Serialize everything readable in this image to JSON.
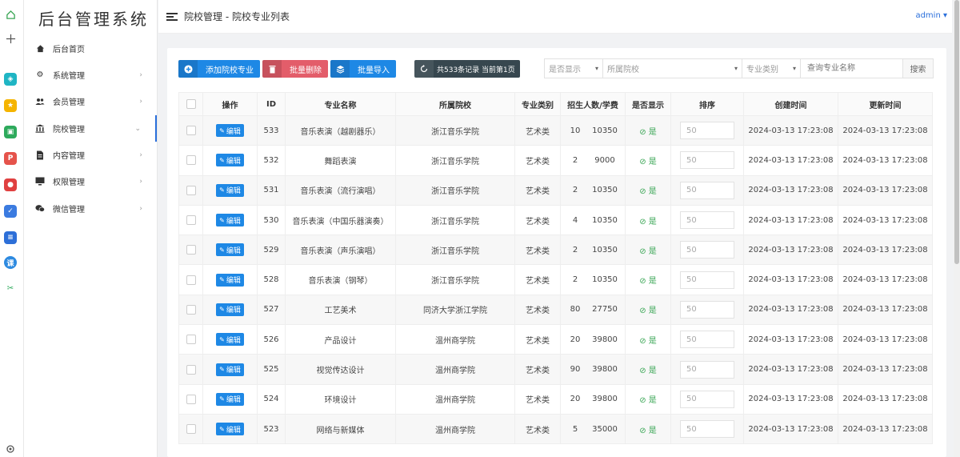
{
  "app": {
    "title": "后台管理系统",
    "user": "admin"
  },
  "header": {
    "breadcrumb": "院校管理 - 院校专业列表"
  },
  "sidebar": {
    "items": [
      {
        "label": "后台首页",
        "icon": "home-icon"
      },
      {
        "label": "系统管理",
        "icon": "gear-icon"
      },
      {
        "label": "会员管理",
        "icon": "users-icon"
      },
      {
        "label": "院校管理",
        "icon": "institution-icon"
      },
      {
        "label": "内容管理",
        "icon": "document-icon"
      },
      {
        "label": "权限管理",
        "icon": "monitor-icon"
      },
      {
        "label": "微信管理",
        "icon": "wechat-icon"
      }
    ]
  },
  "toolbar": {
    "add_label": "添加院校专业",
    "delete_label": "批量删除",
    "import_label": "批量导入",
    "record_info": "共533条记录 当前第1页"
  },
  "filters": {
    "show": "是否显示",
    "school": "所属院校",
    "category": "专业类别",
    "search_placeholder": "查询专业名称",
    "search_button": "搜索"
  },
  "table": {
    "headers": [
      "操作",
      "ID",
      "专业名称",
      "所属院校",
      "专业类别",
      "招生人数/学费",
      "是否显示",
      "排序",
      "创建时间",
      "更新时间"
    ],
    "edit_label": "编辑",
    "yes_label": "是",
    "rows": [
      {
        "id": "533",
        "name": "音乐表演（越剧器乐）",
        "school": "浙江音乐学院",
        "category": "艺术类",
        "enroll": "10",
        "fee": "10350",
        "sort": "50",
        "created": "2024-03-13 17:23:08",
        "updated": "2024-03-13 17:23:08"
      },
      {
        "id": "532",
        "name": "舞蹈表演",
        "school": "浙江音乐学院",
        "category": "艺术类",
        "enroll": "2",
        "fee": "9000",
        "sort": "50",
        "created": "2024-03-13 17:23:08",
        "updated": "2024-03-13 17:23:08"
      },
      {
        "id": "531",
        "name": "音乐表演（流行演唱）",
        "school": "浙江音乐学院",
        "category": "艺术类",
        "enroll": "2",
        "fee": "10350",
        "sort": "50",
        "created": "2024-03-13 17:23:08",
        "updated": "2024-03-13 17:23:08"
      },
      {
        "id": "530",
        "name": "音乐表演（中国乐器演奏）",
        "school": "浙江音乐学院",
        "category": "艺术类",
        "enroll": "4",
        "fee": "10350",
        "sort": "50",
        "created": "2024-03-13 17:23:08",
        "updated": "2024-03-13 17:23:08"
      },
      {
        "id": "529",
        "name": "音乐表演（声乐演唱）",
        "school": "浙江音乐学院",
        "category": "艺术类",
        "enroll": "2",
        "fee": "10350",
        "sort": "50",
        "created": "2024-03-13 17:23:08",
        "updated": "2024-03-13 17:23:08"
      },
      {
        "id": "528",
        "name": "音乐表演（钢琴）",
        "school": "浙江音乐学院",
        "category": "艺术类",
        "enroll": "2",
        "fee": "10350",
        "sort": "50",
        "created": "2024-03-13 17:23:08",
        "updated": "2024-03-13 17:23:08"
      },
      {
        "id": "527",
        "name": "工艺美术",
        "school": "同济大学浙江学院",
        "category": "艺术类",
        "enroll": "80",
        "fee": "27750",
        "sort": "50",
        "created": "2024-03-13 17:23:08",
        "updated": "2024-03-13 17:23:08"
      },
      {
        "id": "526",
        "name": "产品设计",
        "school": "温州商学院",
        "category": "艺术类",
        "enroll": "20",
        "fee": "39800",
        "sort": "50",
        "created": "2024-03-13 17:23:08",
        "updated": "2024-03-13 17:23:08"
      },
      {
        "id": "525",
        "name": "视觉传达设计",
        "school": "温州商学院",
        "category": "艺术类",
        "enroll": "90",
        "fee": "39800",
        "sort": "50",
        "created": "2024-03-13 17:23:08",
        "updated": "2024-03-13 17:23:08"
      },
      {
        "id": "524",
        "name": "环境设计",
        "school": "温州商学院",
        "category": "艺术类",
        "enroll": "20",
        "fee": "39800",
        "sort": "50",
        "created": "2024-03-13 17:23:08",
        "updated": "2024-03-13 17:23:08"
      },
      {
        "id": "523",
        "name": "网络与新媒体",
        "school": "温州商学院",
        "category": "艺术类",
        "enroll": "5",
        "fee": "35000",
        "sort": "50",
        "created": "2024-03-13 17:23:08",
        "updated": "2024-03-13 17:23:08"
      }
    ]
  },
  "colors": {
    "primary": "#1e88e5",
    "danger": "#e35d6a",
    "dark": "#37474f",
    "success": "#3aa655",
    "link": "#2a6fdb"
  }
}
